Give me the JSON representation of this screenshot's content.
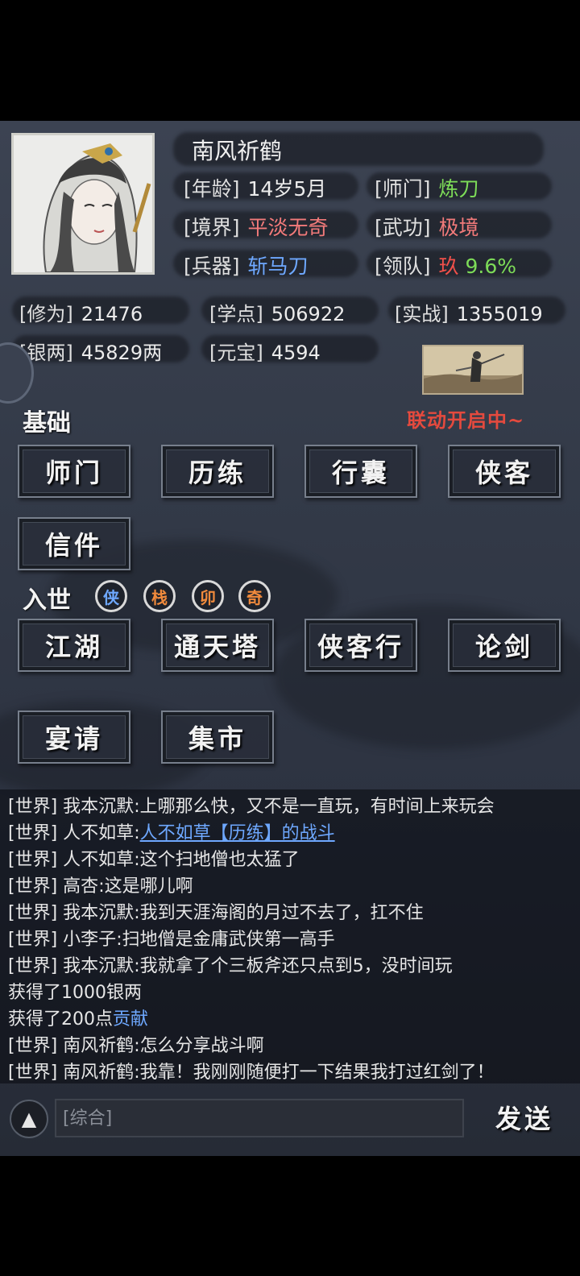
{
  "player": {
    "name": "南风祈鹤",
    "stats_right_col": [],
    "age_label": "[年龄]",
    "age_value": "14岁5月",
    "sect_label": "[师门]",
    "sect_value": "炼刀",
    "realm_label": "[境界]",
    "realm_value": "平淡无奇",
    "martial_label": "[武功]",
    "martial_value": "极境",
    "weapon_label": "[兵器]",
    "weapon_value": "斩马刀",
    "team_label": "[领队]",
    "team_value": "玖",
    "team_percent": "9.6%"
  },
  "resources": {
    "cultivation_label": "[修为]",
    "cultivation_value": "21476",
    "study_label": "[学点]",
    "study_value": "506922",
    "combat_label": "[实战]",
    "combat_value": "1355019",
    "silver_label": "[银两]",
    "silver_value": "45829两",
    "ingot_label": "[元宝]",
    "ingot_value": "4594"
  },
  "event": {
    "text": "联动开启中~"
  },
  "basic": {
    "title": "基础",
    "buttons": [
      "师门",
      "历练",
      "行囊",
      "侠客",
      "信件"
    ]
  },
  "world": {
    "title": "入世",
    "seals": [
      "侠",
      "栈",
      "卯",
      "奇"
    ],
    "buttons": [
      "江湖",
      "通天塔",
      "侠客行",
      "论剑",
      "宴请",
      "集市"
    ]
  },
  "chat": {
    "lines": [
      {
        "channel": "[世界]",
        "user": "我本沉默",
        "text": ":上哪那么快，又不是一直玩，有时间上来玩会"
      },
      {
        "channel": "[世界]",
        "user": "人不如草",
        "sep": ":",
        "link": "人不如草【历练】的战斗"
      },
      {
        "channel": "[世界]",
        "user": "人不如草",
        "text": ":这个扫地僧也太猛了"
      },
      {
        "channel": "[世界]",
        "user": "高杏",
        "text": ":这是哪儿啊"
      },
      {
        "channel": "[世界]",
        "user": "我本沉默",
        "text": ":我到天涯海阁的月过不去了，扛不住"
      },
      {
        "channel": "[世界]",
        "user": "小李子",
        "text": ":扫地僧是金庸武侠第一高手"
      },
      {
        "channel": "[世界]",
        "user": "我本沉默",
        "text": ":我就拿了个三板斧还只点到5，没时间玩"
      }
    ],
    "sys1": "获得了1000银两",
    "sys2_prefix": "获得了200点",
    "sys2_highlight": "贡献",
    "lines2": [
      {
        "channel": "[世界]",
        "user": "南风祈鹤",
        "text": ":怎么分享战斗啊"
      },
      {
        "channel": "[世界]",
        "user": "南风祈鹤",
        "text": ":我靠！我刚刚随便打一下结果我打过红剑了！"
      }
    ]
  },
  "input": {
    "placeholder": "[综合]",
    "up_icon": "▲",
    "send_label": "发送"
  },
  "colors": {
    "green": "#7ddc58",
    "red": "#f0504a",
    "pink": "#f27a7a",
    "blue": "#6ea8ff",
    "seal_colors": [
      "#6ea8ff",
      "#f08a3c",
      "#f08a3c",
      "#f08a3c"
    ]
  }
}
